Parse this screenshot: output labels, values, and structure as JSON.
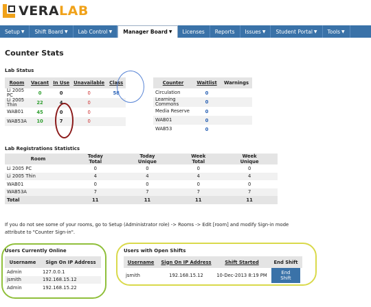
{
  "brand": {
    "part1": "VERA",
    "part2": "LAB"
  },
  "nav": [
    {
      "label": "Setup",
      "caret": "▼"
    },
    {
      "label": "Shift Board",
      "caret": "▼"
    },
    {
      "label": "Lab Control",
      "caret": "▼"
    },
    {
      "label": "Manager Board",
      "caret": "▼",
      "active": true
    },
    {
      "label": "Licenses",
      "caret": ""
    },
    {
      "label": "Reports",
      "caret": ""
    },
    {
      "label": "Issues",
      "caret": "▼"
    },
    {
      "label": "Student Portal",
      "caret": "▼"
    },
    {
      "label": "Tools",
      "caret": "▼"
    }
  ],
  "page_title": "Counter Stats",
  "lab_status": {
    "title": "Lab Status",
    "headers": [
      "Room",
      "Vacant",
      "In Use",
      "Unavailable",
      "Class"
    ],
    "rows": [
      {
        "room": "Li 2005 PC",
        "vacant": "0",
        "in_use": "0",
        "unavailable": "0",
        "class": "58"
      },
      {
        "room": "Li 2005 Thin",
        "vacant": "22",
        "in_use": "4",
        "unavailable": "0",
        "class": ""
      },
      {
        "room": "WAB01",
        "vacant": "45",
        "in_use": "0",
        "unavailable": "0",
        "class": ""
      },
      {
        "room": "WAB53A",
        "vacant": "10",
        "in_use": "7",
        "unavailable": "0",
        "class": ""
      }
    ]
  },
  "counter_table": {
    "headers": [
      "Counter",
      "Waitlist",
      "Warnings"
    ],
    "rows": [
      {
        "counter": "Circulation",
        "waitlist": "0",
        "warnings": ""
      },
      {
        "counter": "Learning Commons",
        "waitlist": "0",
        "warnings": ""
      },
      {
        "counter": "Media Reserve",
        "waitlist": "0",
        "warnings": ""
      },
      {
        "counter": "WAB01",
        "waitlist": "0",
        "warnings": ""
      },
      {
        "counter": "WAB53",
        "waitlist": "0",
        "warnings": ""
      }
    ]
  },
  "registrations": {
    "title": "Lab Registrations Statistics",
    "headers": [
      {
        "l1": "Room",
        "l2": ""
      },
      {
        "l1": "Today",
        "l2": "Total"
      },
      {
        "l1": "Today",
        "l2": "Unique"
      },
      {
        "l1": "Week",
        "l2": "Total"
      },
      {
        "l1": "Week",
        "l2": "Unique"
      }
    ],
    "rows": [
      [
        "Li 2005 PC",
        "0",
        "0",
        "0",
        "0"
      ],
      [
        "Li 2005 Thin",
        "4",
        "4",
        "4",
        "4"
      ],
      [
        "WAB01",
        "0",
        "0",
        "0",
        "0"
      ],
      [
        "WAB53A",
        "7",
        "7",
        "7",
        "7"
      ]
    ],
    "total": [
      "Total",
      "11",
      "11",
      "11",
      "11"
    ]
  },
  "note": "If you do not see some of your rooms, go to Setup (Administrator role) -> Rooms -> Edit [room] and modify Sign-in mode attribute to \"Counter Sign-in\".",
  "users_online": {
    "title": "Users Currently Online",
    "headers": [
      "Username",
      "Sign On IP Address"
    ],
    "rows": [
      [
        "Admin",
        "127.0.0.1"
      ],
      [
        "jsmith",
        "192.168.15.12"
      ],
      [
        "Admin",
        "192.168.15.22"
      ]
    ]
  },
  "open_shifts": {
    "title": "Users with Open Shifts",
    "headers": [
      "Username",
      "Sign On IP Address",
      "Shift Started",
      "End Shift"
    ],
    "rows": [
      {
        "username": "jsmith",
        "ip": "192.168.15.12",
        "started": "10-Dec-2013 8:19 PM",
        "button": "End Shift"
      }
    ]
  },
  "annotation_colors": {
    "blue": "#5a86d6",
    "red": "#8b1a1a",
    "green": "#8fbf3a",
    "yellow": "#d9d94a"
  }
}
